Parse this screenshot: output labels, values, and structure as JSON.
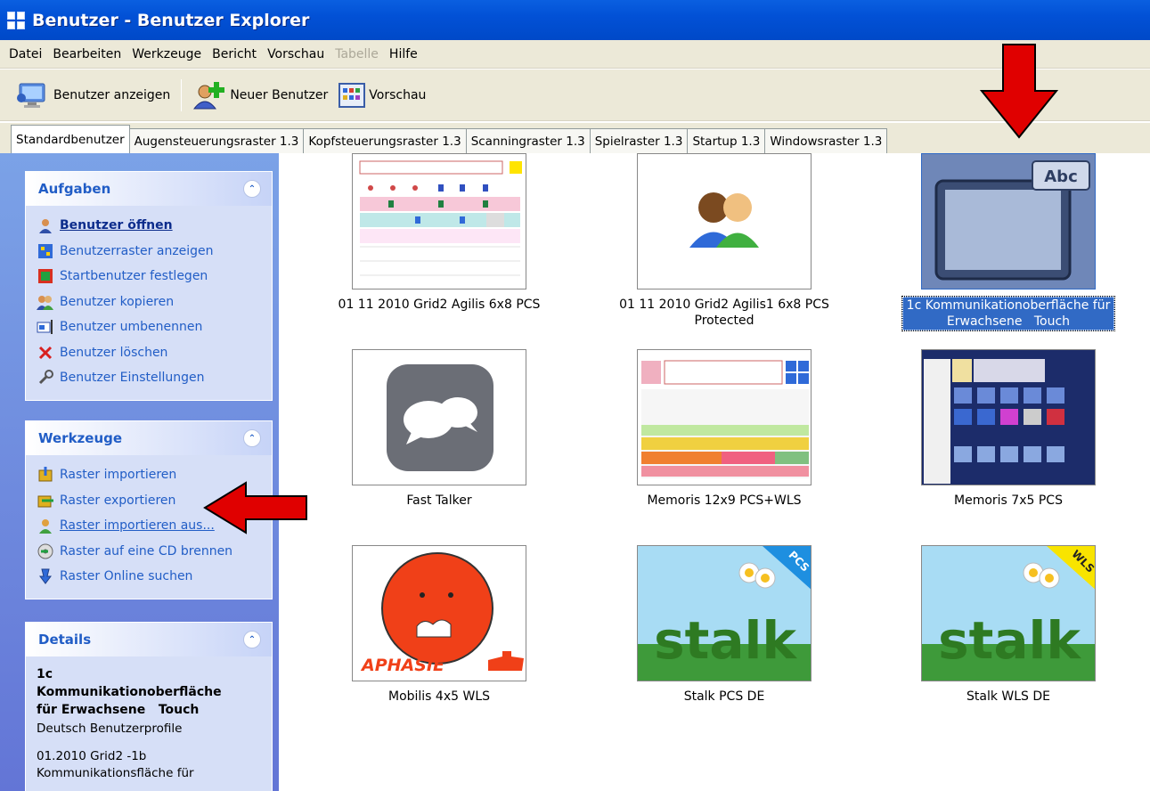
{
  "window": {
    "title": "Benutzer - Benutzer Explorer"
  },
  "menu": [
    {
      "label": "Datei",
      "disabled": false
    },
    {
      "label": "Bearbeiten",
      "disabled": false
    },
    {
      "label": "Werkzeuge",
      "disabled": false
    },
    {
      "label": "Bericht",
      "disabled": false
    },
    {
      "label": "Vorschau",
      "disabled": false
    },
    {
      "label": "Tabelle",
      "disabled": true
    },
    {
      "label": "Hilfe",
      "disabled": false
    }
  ],
  "toolbar": {
    "show_user": "Benutzer anzeigen",
    "new_user": "Neuer Benutzer",
    "preview": "Vorschau"
  },
  "tabs": [
    "Standardbenutzer",
    "Augensteuerungsraster 1.3",
    "Kopfsteuerungsraster 1.3",
    "Scanningraster 1.3",
    "Spielraster 1.3",
    "Startup 1.3",
    "Windowsraster 1.3"
  ],
  "sidebar": {
    "tasks": {
      "title": "Aufgaben",
      "items": [
        "Benutzer öffnen",
        "Benutzerraster anzeigen",
        "Startbenutzer festlegen",
        "Benutzer kopieren",
        "Benutzer umbenennen",
        "Benutzer löschen",
        "Benutzer Einstellungen"
      ]
    },
    "tools": {
      "title": "Werkzeuge",
      "items": [
        "Raster importieren",
        "Raster exportieren",
        "Raster importieren aus...",
        "Raster auf eine CD brennen",
        "Raster Online suchen"
      ]
    },
    "details": {
      "title": "Details",
      "name_line1": "1c",
      "name_line2": "Kommunikationoberfläche",
      "name_line3": "für Erwachsene   Touch",
      "profile": "Deutsch Benutzerprofile",
      "desc_line1": "01.2010 Grid2 -1b",
      "desc_line2": "Kommunikationsfläche für"
    }
  },
  "users": [
    {
      "caption": "01 11 2010 Grid2 Agilis 6x8 PCS"
    },
    {
      "caption": "01 11 2010 Grid2 Agilis1 6x8 PCS Protected"
    },
    {
      "caption": "1c Kommunikationoberfläche für Erwachsene   Touch",
      "selected": true,
      "badge": "Abc"
    },
    {
      "caption": "Fast Talker"
    },
    {
      "caption": "Memoris 12x9 PCS+WLS"
    },
    {
      "caption": "Memoris 7x5 PCS"
    },
    {
      "caption": "Mobilis 4x5 WLS",
      "badge": "APHASIE"
    },
    {
      "caption": "Stalk PCS DE",
      "badge": "PCS",
      "word": "stalk"
    },
    {
      "caption": "Stalk WLS DE",
      "badge": "WLS",
      "word": "stalk"
    }
  ],
  "colors": {
    "titlebar": "#0251d6",
    "sidebar": "#6f8ee0",
    "selection": "#316ac5",
    "arrow": "#e00000"
  }
}
